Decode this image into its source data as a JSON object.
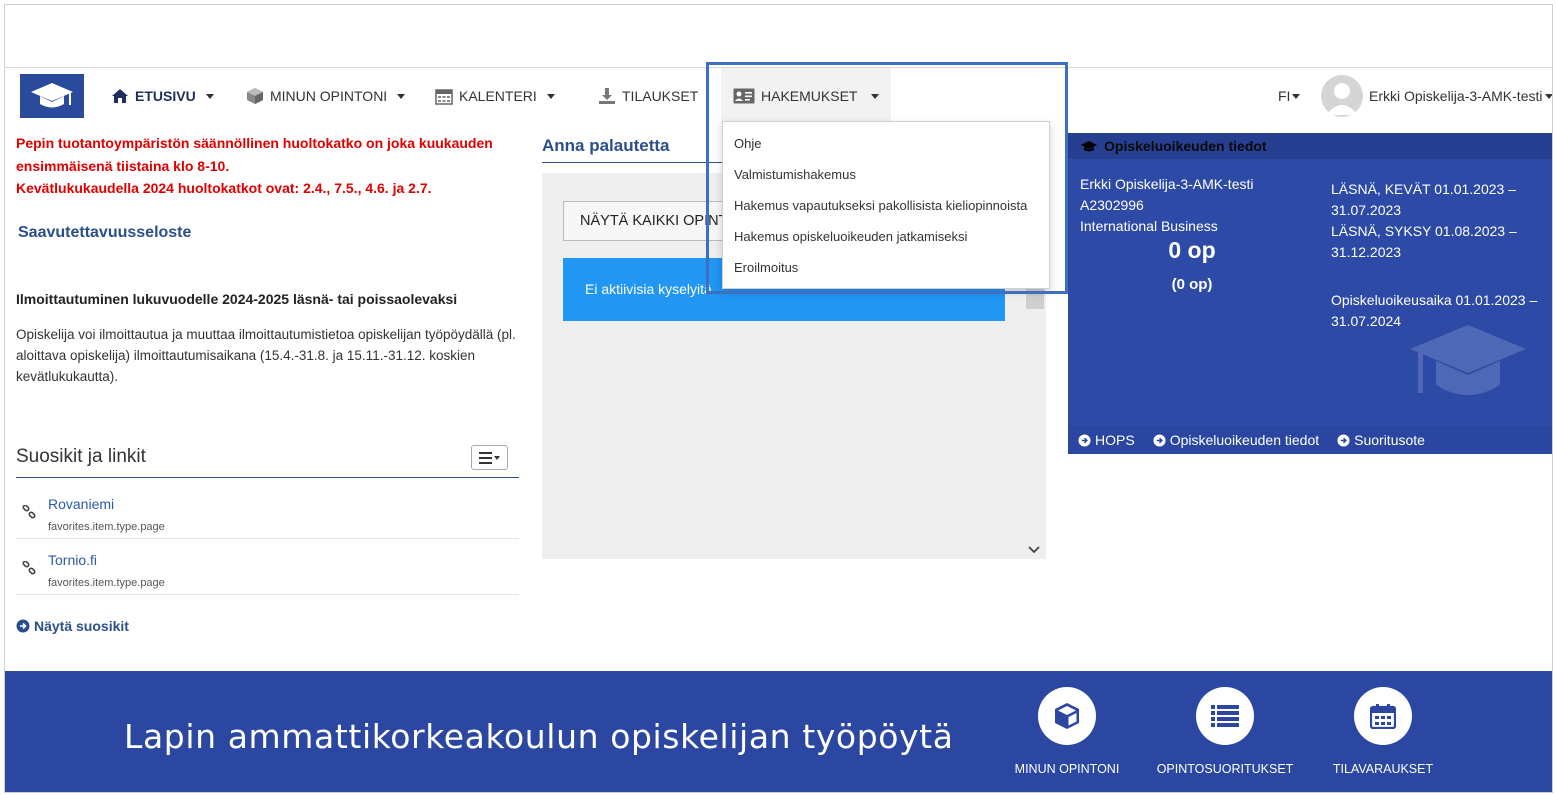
{
  "nav": {
    "etusivu": "ETUSIVU",
    "minun_opintoni": "MINUN OPINTONI",
    "kalenteri": "KALENTERI",
    "tilaukset": "TILAUKSET",
    "hakemukset": "HAKEMUKSET",
    "lang": "FI",
    "user_name": "Erkki Opiskelija-3-AMK-testi"
  },
  "dropdown": {
    "items": [
      "Ohje",
      "Valmistumishakemus",
      "Hakemus vapautukseksi pakollisista kieliopinnoista",
      "Hakemus opiskeluoikeuden jatkamiseksi",
      "Eroilmoitus"
    ]
  },
  "left": {
    "notice_line1": "Pepin tuotantoympäristön säännöllinen huoltokatko on joka kuukauden ensimmäisenä tiistaina klo 8-10.",
    "notice_line2": "Kevätlukukaudella 2024 huoltokatkot ovat: 2.4., 7.5., 4.6. ja 2.7.",
    "accessibility": "Saavutettavuusseloste",
    "registration_title": "Ilmoittautuminen lukuvuodelle 2024-2025 läsnä- tai poissaolevaksi",
    "registration_text": "Opiskelija voi ilmoittautua ja muuttaa ilmoittautumistietoa opiskelijan työpöydällä (pl. aloittava opiskelija) ilmoittautumisaikana (15.4.-31.8. ja 15.11.-31.12. koskien kevätlukukautta).",
    "favorites_title": "Suosikit ja linkit",
    "favorites": [
      {
        "name": "Rovaniemi",
        "type": "favorites.item.type.page"
      },
      {
        "name": "Tornio.fi",
        "type": "favorites.item.type.page"
      }
    ],
    "show_favorites": "Näytä suosikit"
  },
  "feedback": {
    "title": "Anna palautetta",
    "button": "NÄYTÄ KAIKKI OPINTOJAKSOT",
    "empty": "Ei aktiivisia kyselyitä"
  },
  "card": {
    "title": "Opiskeluoikeuden tiedot",
    "name": "Erkki Opiskelija-3-AMK-testi",
    "student_id": "A2302996",
    "programme": "International Business",
    "credits": "0 op",
    "credits_sub": "(0 op)",
    "presence1": "LÄSNÄ, KEVÄT 01.01.2023 – 31.07.2023",
    "presence2": "LÄSNÄ, SYKSY 01.08.2023 – 31.12.2023",
    "study_right": "Opiskeluoikeusaika 01.01.2023 – 31.07.2024",
    "links": [
      "HOPS",
      "Opiskeluoikeuden tiedot",
      "Suoritusote"
    ]
  },
  "footer": {
    "title": "Lapin ammattikorkeakoulun opiskelijan työpöytä",
    "buttons": [
      "MINUN OPINTONI",
      "OPINTOSUORITUKSET",
      "TILAVARAUKSET"
    ]
  },
  "colors": {
    "brand": "#2b47a2",
    "notice": "#e00000",
    "link": "#2b5aa5",
    "info": "#2196f3",
    "highlight": "#3f6fc2"
  }
}
